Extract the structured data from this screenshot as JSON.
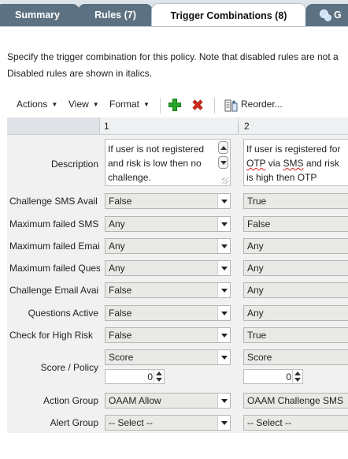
{
  "tabs": [
    {
      "label": "Summary"
    },
    {
      "label": "Rules (7)"
    },
    {
      "label": "Trigger Combinations (8)"
    },
    {
      "label": "G"
    }
  ],
  "instructions": {
    "line1": "Specify the trigger combination for this policy. Note that disabled rules are not a",
    "line2": "Disabled rules are shown in italics."
  },
  "toolbar": {
    "actions": "Actions",
    "view": "View",
    "format": "Format",
    "reorder": "Reorder..."
  },
  "columns": {
    "c1": "1",
    "c2": "2"
  },
  "rows": {
    "description": {
      "label": "Description",
      "c1_lines": [
        "If user is not registered",
        "and risk is low then no",
        "challenge."
      ],
      "c2_lines": [
        "If user is registered for",
        "OTP via SMS and risk",
        "is high then OTP"
      ]
    },
    "challenge_sms": {
      "label": "Challenge SMS Avail",
      "c1": "False",
      "c2": "True"
    },
    "max_failed_sms": {
      "label": "Maximum failed SMS",
      "c1": "Any",
      "c2": "False"
    },
    "max_failed_email": {
      "label": "Maximum failed Emai",
      "c1": "Any",
      "c2": "Any"
    },
    "max_failed_ques": {
      "label": "Maximum failed Ques",
      "c1": "Any",
      "c2": "Any"
    },
    "challenge_email": {
      "label": "Challenge Email Avai",
      "c1": "False",
      "c2": "Any"
    },
    "questions_active": {
      "label": "Questions Active",
      "c1": "False",
      "c2": "Any"
    },
    "check_high_risk": {
      "label": "Check for High Risk",
      "c1": "False",
      "c2": "True"
    },
    "score_policy": {
      "label": "Score / Policy",
      "c1": "Score",
      "c2": "Score",
      "c1_value": "0",
      "c2_value": "0"
    },
    "action_group": {
      "label": "Action Group",
      "c1": "OAAM Allow",
      "c2": "OAAM Challenge SMS"
    },
    "alert_group": {
      "label": "Alert Group",
      "c1": "-- Select --",
      "c2": "-- Select --"
    }
  },
  "colors": {
    "tab_inactive": "#5c7282",
    "add_icon": "#2aa52a",
    "delete_icon": "#d42a1a"
  },
  "icons": [
    "add-icon",
    "delete-icon",
    "reorder-icon",
    "group-icon"
  ]
}
